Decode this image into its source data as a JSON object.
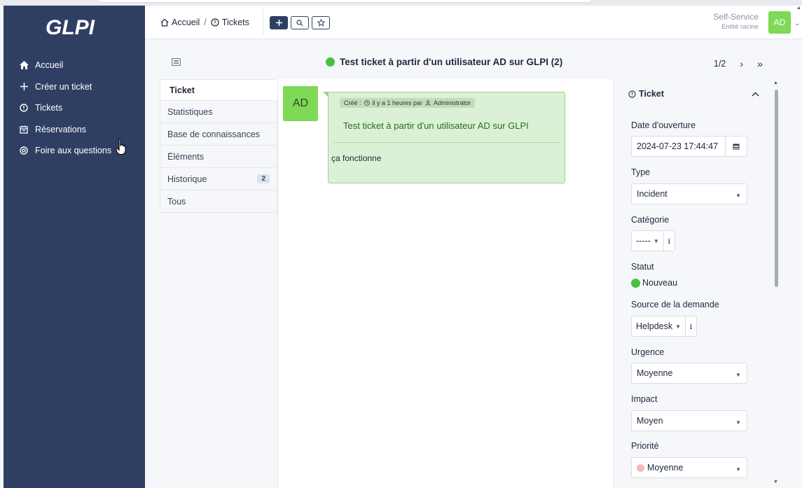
{
  "app": {
    "logo_text": "GLPI"
  },
  "sidebar": {
    "items": [
      {
        "label": "Accueil",
        "icon": "home-icon"
      },
      {
        "label": "Créer un ticket",
        "icon": "plus-icon"
      },
      {
        "label": "Tickets",
        "icon": "alert-circle-icon"
      },
      {
        "label": "Réservations",
        "icon": "calendar-icon"
      },
      {
        "label": "Foire aux questions",
        "icon": "help-icon"
      }
    ]
  },
  "header": {
    "breadcrumb": {
      "home": "Accueil",
      "separator": "/",
      "current": "Tickets"
    },
    "profile": {
      "name": "Self-Service",
      "entity": "Entité racine"
    },
    "avatar_initials": "AD"
  },
  "ticket": {
    "title": "Test ticket à partir d'un utilisateur AD sur GLPI (2)",
    "status_color": "#4bbf3f",
    "pager": {
      "position": "1/2",
      "next": "›",
      "last": "»"
    }
  },
  "tabs": [
    {
      "label": "Ticket",
      "active": true
    },
    {
      "label": "Statistiques"
    },
    {
      "label": "Base de connaissances"
    },
    {
      "label": "Éléments"
    },
    {
      "label": "Historique",
      "badge": "2"
    },
    {
      "label": "Tous"
    }
  ],
  "timeline": {
    "avatar_initials": "AD",
    "meta_created": "Créé :",
    "meta_time": "il y a 1 heures par",
    "meta_author": "Administrator",
    "title": "Test ticket à partir d'un utilisateur AD sur GLPI",
    "content": "ça fonctionne"
  },
  "details": {
    "section_title": "Ticket",
    "opening_date_label": "Date d'ouverture",
    "opening_date_value": "2024-07-23 17:44:47",
    "type_label": "Type",
    "type_value": "Incident",
    "category_label": "Catégorie",
    "category_value": "-----",
    "info_glyph": "i",
    "status_label": "Statut",
    "status_value": "Nouveau",
    "source_label": "Source de la demande",
    "source_value": "Helpdesk",
    "urgency_label": "Urgence",
    "urgency_value": "Moyenne",
    "impact_label": "Impact",
    "impact_value": "Moyen",
    "priority_label": "Priorité",
    "priority_value": "Moyenne",
    "priority_color": "#f6b8bd"
  },
  "colors": {
    "sidebar": "#2f3f64",
    "accent_green": "#7ed957",
    "followup_bg": "#dbf1d6"
  }
}
